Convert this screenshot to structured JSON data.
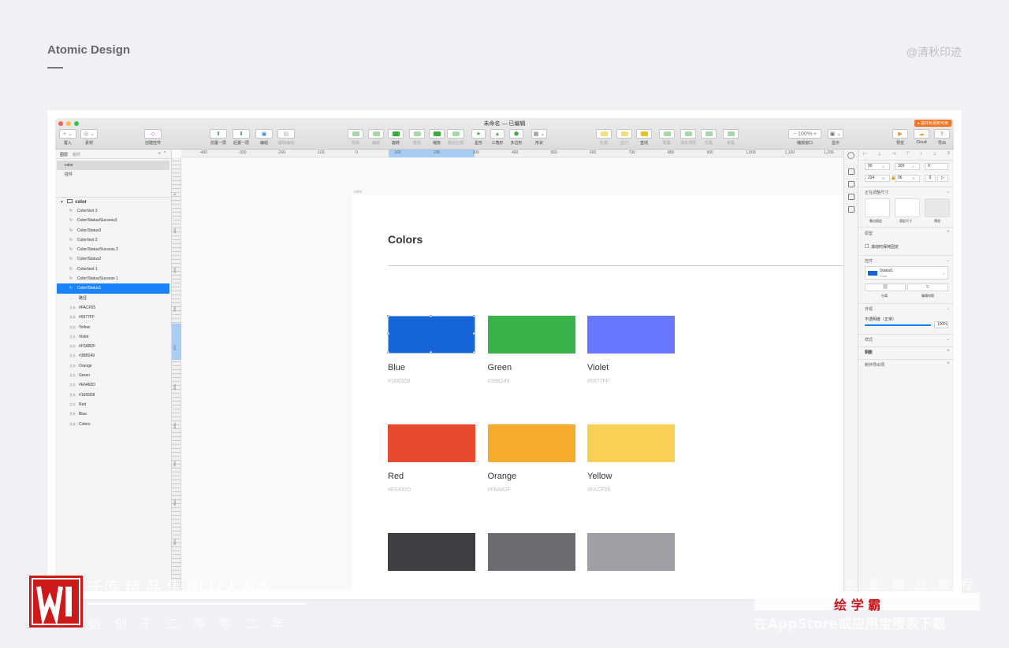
{
  "page": {
    "title": "Atomic Design",
    "credit": "@清秋印迹"
  },
  "window": {
    "doc_title": "未命名 — 已编辑",
    "update_badge": "● 插件有更新可用",
    "toolbar": [
      {
        "label": "置入",
        "glyph": "+ ⌄",
        "dim": false
      },
      {
        "label": "素材",
        "glyph": "◎ ⌄",
        "dim": false
      },
      {
        "label": "创建控件",
        "glyph": "◇",
        "dim": false
      },
      {
        "label": "前置一层",
        "glyph": "⬆",
        "dim": false
      },
      {
        "label": "后置一层",
        "glyph": "⬇",
        "dim": false
      },
      {
        "label": "编组",
        "glyph": "▣",
        "dim": false
      },
      {
        "label": "解除编组",
        "glyph": "▤",
        "dim": true
      },
      {
        "label": "变换",
        "glyph": "",
        "dim": true
      },
      {
        "label": "编辑",
        "glyph": "",
        "dim": true
      },
      {
        "label": "旋转",
        "glyph": "",
        "dim": false
      },
      {
        "label": "蒙版",
        "glyph": "",
        "dim": true
      },
      {
        "label": "缩放",
        "glyph": "",
        "dim": false
      },
      {
        "label": "路径轮廓",
        "glyph": "",
        "dim": true
      },
      {
        "label": "星形",
        "glyph": "★",
        "dim": false
      },
      {
        "label": "三角形",
        "glyph": "▲",
        "dim": false
      },
      {
        "label": "多边形",
        "glyph": "⬟",
        "dim": false
      },
      {
        "label": "形状",
        "glyph": "▦ ⌄",
        "dim": false
      },
      {
        "label": "轮廓",
        "glyph": "",
        "dim": true
      },
      {
        "label": "剪刀",
        "glyph": "",
        "dim": true
      },
      {
        "label": "直线",
        "glyph": "",
        "dim": false
      },
      {
        "label": "联集",
        "glyph": "",
        "dim": true
      },
      {
        "label": "减去顶层",
        "glyph": "",
        "dim": true
      },
      {
        "label": "交集",
        "glyph": "",
        "dim": true
      },
      {
        "label": "差集",
        "glyph": "",
        "dim": true
      },
      {
        "label": "缩放窗口",
        "glyph": "− 100% +",
        "dim": false
      },
      {
        "label": "显示",
        "glyph": "▣ ⌄",
        "dim": false
      },
      {
        "label": "预览",
        "glyph": "▶",
        "dim": false
      },
      {
        "label": "Cloud",
        "glyph": "☁",
        "dim": false
      },
      {
        "label": "导出",
        "glyph": "⇪",
        "dim": false
      }
    ],
    "left_panel": {
      "tabs": [
        "图层",
        "组件"
      ],
      "pages": [
        "color",
        "控件"
      ],
      "artboard_name": "color",
      "layers": [
        {
          "type": "symbol",
          "name": "Color/text 3"
        },
        {
          "type": "symbol",
          "name": "Color/Status/Success3"
        },
        {
          "type": "symbol",
          "name": "Color/Status3"
        },
        {
          "type": "symbol",
          "name": "Color/text 2"
        },
        {
          "type": "symbol",
          "name": "Color/Status/Success 2"
        },
        {
          "type": "symbol",
          "name": "Color/Status2"
        },
        {
          "type": "symbol",
          "name": "Color/text 1"
        },
        {
          "type": "symbol",
          "name": "Color/Status/Success 1"
        },
        {
          "type": "symbol",
          "name": "Color/Status1",
          "selected": true
        },
        {
          "type": "path",
          "name": "路径"
        },
        {
          "type": "text",
          "name": "#FACF55"
        },
        {
          "type": "text",
          "name": "#6977FF"
        },
        {
          "type": "text",
          "name": "Yellow"
        },
        {
          "type": "text",
          "name": "Violet"
        },
        {
          "type": "text",
          "name": "#F6AB2F"
        },
        {
          "type": "text",
          "name": "#38B249"
        },
        {
          "type": "text",
          "name": "Orange"
        },
        {
          "type": "text",
          "name": "Green"
        },
        {
          "type": "text",
          "name": "#E6492D"
        },
        {
          "type": "text",
          "name": "#1665D8"
        },
        {
          "type": "text",
          "name": "Red"
        },
        {
          "type": "text",
          "name": "Blue"
        },
        {
          "type": "text",
          "name": "Colors"
        }
      ],
      "text_prefix": "文本",
      "path_prefix": "—"
    },
    "rulers": {
      "h_ticks": [
        "-400",
        "-300",
        "-200",
        "-100",
        "0",
        "100",
        "200",
        "300",
        "400",
        "500",
        "600",
        "700",
        "800",
        "900",
        "1,000",
        "1,100",
        "1,200"
      ],
      "v_ticks": [
        "0",
        "100",
        "200",
        "300",
        "400",
        "500",
        "600",
        "700",
        "800",
        "900"
      ]
    },
    "artboard": {
      "label": "color",
      "heading": "Colors",
      "swatches": [
        {
          "name": "Blue",
          "hex": "#1665D8",
          "color": "#1665D8"
        },
        {
          "name": "Green",
          "hex": "#38B249",
          "color": "#38B249"
        },
        {
          "name": "Violet",
          "hex": "#6977FF",
          "color": "#6977FF"
        },
        {
          "name": "Red",
          "hex": "#E6492D",
          "color": "#E6492D"
        },
        {
          "name": "Orange",
          "hex": "#F6AB2F",
          "color": "#F6AB2F"
        },
        {
          "name": "Yellow",
          "hex": "#FACF55",
          "color": "#FACF55"
        },
        {
          "name": "",
          "hex": "",
          "color": "#3E3F42"
        },
        {
          "name": "",
          "hex": "",
          "color": "#6B6C6F"
        },
        {
          "name": "",
          "hex": "",
          "color": "#9EA0A5"
        }
      ]
    },
    "inspector": {
      "x": "90",
      "x_unit": "X",
      "y": "309",
      "y_unit": "Y",
      "rotation": "0",
      "w": "224",
      "w_unit": "W",
      "h": "96",
      "h_unit": "H",
      "resizing_title": "正在调整尺寸",
      "resizing_options": [
        "靠边固定",
        "固定尺寸",
        "预览"
      ],
      "prototype_title": "原型",
      "fix_scroll": "滚动时保持固定",
      "symbol_title": "控件",
      "symbol_name": "Status1",
      "symbol_sub": "Color",
      "detach": "分离",
      "edit_master": "编辑母版",
      "appearance_title": "外观",
      "opacity_label": "不透明度（正常）",
      "opacity_value": "100%",
      "style_title": "样式",
      "shadow_title": "阴影",
      "export_title": "制作导出项"
    }
  },
  "watermark": {
    "line1": "千库 精 品 集 团  以人为本",
    "line2": "始 创 于 二 零 零 二 年",
    "right1": "免 费 精 品 教 程",
    "right_brand": "绘 学 霸",
    "right2": "在AppStore或应用宝搜索下载"
  }
}
